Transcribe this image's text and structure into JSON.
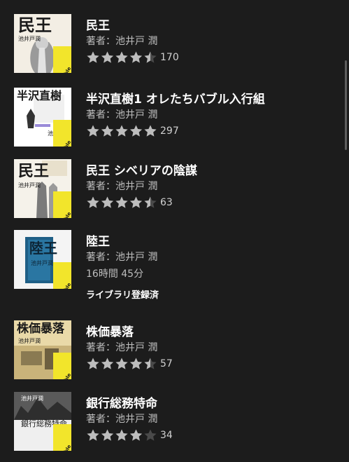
{
  "colors": {
    "background": "#1c1c1c",
    "star": "#bdbdbd",
    "badge": "#f2e52b"
  },
  "books": [
    {
      "title": "民王",
      "author": "著者：池井戸 潤",
      "rating": 4.5,
      "count": "170",
      "cover": {
        "title_text": "民王",
        "author_text": "池井戸潤",
        "badge": "audible"
      }
    },
    {
      "title": "半沢直樹1 オレたちバブル入行組",
      "author": "著者：池井戸 潤",
      "rating": 5,
      "count": "297",
      "cover": {
        "title_text": "半沢直樹",
        "author_text": "池井戸潤",
        "badge": "audible"
      }
    },
    {
      "title": "民王 シベリアの陰謀",
      "author": "著者：池井戸 潤",
      "rating": 4.5,
      "count": "63",
      "cover": {
        "title_text": "民王",
        "author_text": "池井戸潤",
        "badge": "audible"
      }
    },
    {
      "title": "陸王",
      "author": "著者：池井戸 潤",
      "duration": "16時間 45分",
      "library": "ライブラリ登録済",
      "cover": {
        "title_text": "陸王",
        "author_text": "池井戸潤",
        "badge": "audible"
      }
    },
    {
      "title": "株価暴落",
      "author": "著者：池井戸 潤",
      "rating": 4.5,
      "count": "57",
      "cover": {
        "title_text": "株価暴落",
        "author_text": "池井戸潤",
        "badge": "audible"
      }
    },
    {
      "title": "銀行総務特命",
      "author": "著者：池井戸 潤",
      "rating": 4,
      "count": "34",
      "cover": {
        "title_text": "銀行総務特命",
        "author_text": "池井戸潤",
        "badge": "audible"
      }
    }
  ]
}
